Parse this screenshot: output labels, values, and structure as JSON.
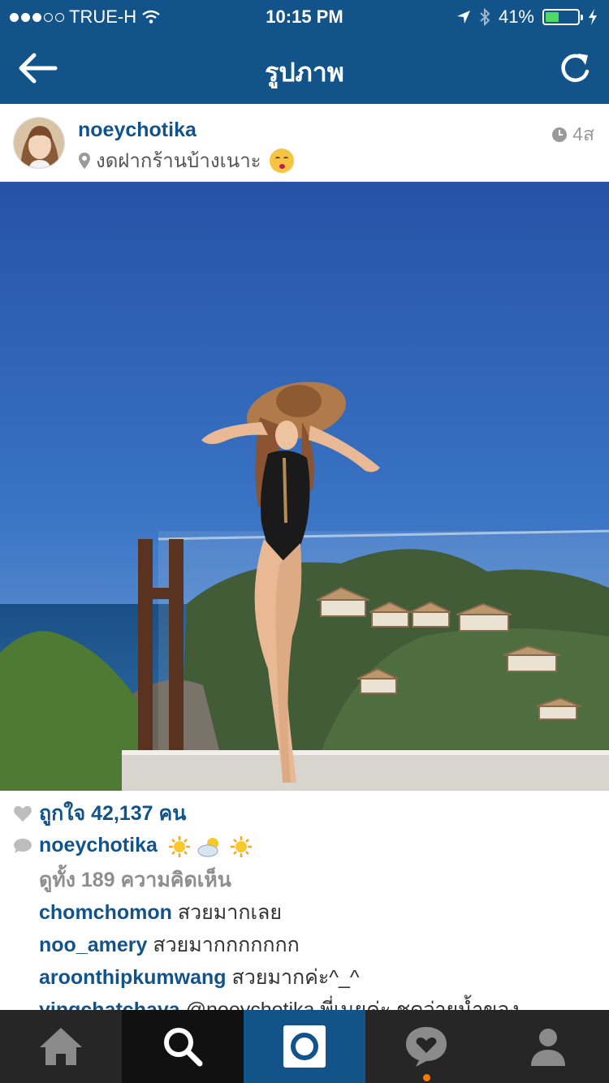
{
  "status_bar": {
    "carrier": "TRUE-H",
    "time": "10:15 PM",
    "battery": "41%",
    "battery_level": 0.41
  },
  "nav": {
    "title": "รูปภาพ"
  },
  "post": {
    "username": "noeychotika",
    "location": "งดฝากร้านบ้างเนาะ",
    "time_ago": "4ส"
  },
  "details": {
    "likes": "ถูกใจ 42,137 คน",
    "caption_user": "noeychotika",
    "view_all_comments": "ดูทั้ง 189 ความคิดเห็น",
    "comments": [
      {
        "user": "chomchomon",
        "text": "สวยมากเลย"
      },
      {
        "user": "noo_amery",
        "text": "สวยมากกกกกกก"
      },
      {
        "user": "aroonthipkumwang",
        "text": "สวยมากค่ะ^_^"
      },
      {
        "user": "yingchatchaya",
        "text": "@noeychotika พี่เนยค่ะ ชุดว่ายน้ำของ"
      }
    ]
  },
  "colors": {
    "brand": "#12548a",
    "tabbar": "#262626",
    "notification": "#f57c00"
  },
  "icons": [
    "back-arrow-icon",
    "refresh-icon",
    "location-pin-icon",
    "clock-icon",
    "heart-icon",
    "comment-icon",
    "home-icon",
    "search-icon",
    "camera-icon",
    "activity-icon",
    "profile-icon"
  ]
}
